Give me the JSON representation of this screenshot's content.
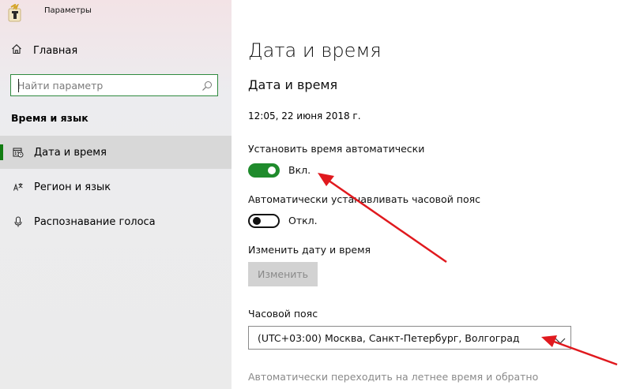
{
  "app": {
    "title": "Параметры"
  },
  "sidebar": {
    "home_label": "Главная",
    "search_placeholder": "Найти параметр",
    "section_title": "Время и язык",
    "items": [
      {
        "label": "Дата и время",
        "icon": "calendar-clock-icon",
        "active": true
      },
      {
        "label": "Регион и язык",
        "icon": "language-icon",
        "active": false
      },
      {
        "label": "Распознавание голоса",
        "icon": "microphone-icon",
        "active": false
      }
    ]
  },
  "main": {
    "page_title": "Дата и время",
    "section_title": "Дата и время",
    "current_datetime": "12:05, 22 июня 2018 г.",
    "auto_time": {
      "label": "Установить время автоматически",
      "state_label": "Вкл.",
      "on": true
    },
    "auto_timezone": {
      "label": "Автоматически устанавливать часовой пояс",
      "state_label": "Откл.",
      "on": false
    },
    "change_datetime": {
      "label": "Изменить дату и время",
      "button_label": "Изменить"
    },
    "timezone": {
      "label": "Часовой пояс",
      "value": "(UTC+03:00) Москва, Санкт-Петербург, Волгоград"
    },
    "dst_label": "Автоматически переходить на летнее время и обратно"
  },
  "colors": {
    "accent": "#107c10",
    "toggle_on": "#1f8b2c",
    "annotation_arrow": "#e0191e"
  }
}
